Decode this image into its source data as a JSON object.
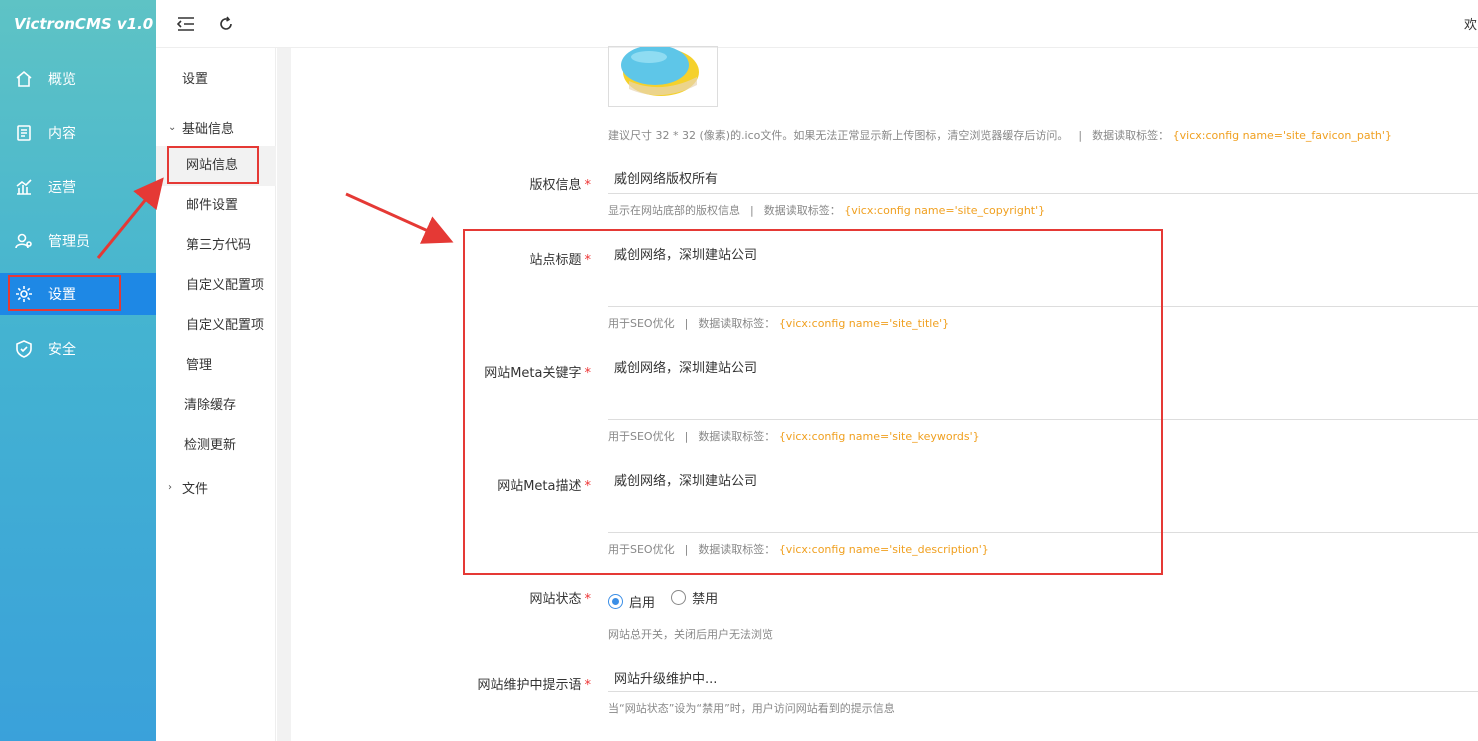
{
  "app": {
    "logo": "VictronCMS v1.0",
    "welcome": "欢"
  },
  "nav": [
    {
      "label": "概览",
      "icon": "home-icon"
    },
    {
      "label": "内容",
      "icon": "document-icon"
    },
    {
      "label": "运营",
      "icon": "chart-icon"
    },
    {
      "label": "管理员",
      "icon": "user-gear-icon"
    },
    {
      "label": "设置",
      "icon": "gear-icon",
      "active": true
    },
    {
      "label": "安全",
      "icon": "shield-icon"
    }
  ],
  "submenu": {
    "title": "设置",
    "group1": "基础信息",
    "items": [
      "网站信息",
      "邮件设置",
      "第三方代码",
      "自定义配置项",
      "自定义配置项",
      "管理",
      "清除缓存",
      "检测更新"
    ],
    "group2": "文件"
  },
  "favicon": {
    "hint": "建议尺寸 32 * 32 (像素)的.ico文件。如果无法正常显示新上传图标，清空浏览器缓存后访问。",
    "hint_label": "数据读取标签：",
    "tag": "{vicx:config name='site_favicon_path'}"
  },
  "copyright": {
    "label": "版权信息",
    "value": "威创网络版权所有",
    "hint": "显示在网站底部的版权信息",
    "hint_label": "数据读取标签：",
    "tag": "{vicx:config name='site_copyright'}"
  },
  "site_title": {
    "label": "站点标题",
    "value": "威创网络，深圳建站公司",
    "hint": "用于SEO优化",
    "hint_label": "数据读取标签：",
    "tag": "{vicx:config name='site_title'}"
  },
  "meta_keywords": {
    "label": "网站Meta关键字",
    "value": "威创网络，深圳建站公司",
    "hint": "用于SEO优化",
    "hint_label": "数据读取标签：",
    "tag": "{vicx:config name='site_keywords'}"
  },
  "meta_desc": {
    "label": "网站Meta描述",
    "value": "威创网络，深圳建站公司",
    "hint": "用于SEO优化",
    "hint_label": "数据读取标签：",
    "tag": "{vicx:config name='site_description'}"
  },
  "site_status": {
    "label": "网站状态",
    "options": [
      "启用",
      "禁用"
    ],
    "selected": "启用",
    "hint": "网站总开关，关闭后用户无法浏览"
  },
  "maintenance": {
    "label": "网站维护中提示语",
    "value": "网站升级维护中...",
    "hint": "当“网站状态”设为“禁用”时，用户访问网站看到的提示信息"
  },
  "colors": {
    "accent": "#1e88e5",
    "required": "#e33333",
    "tag": "#f0a020",
    "annotation": "#e53935"
  }
}
